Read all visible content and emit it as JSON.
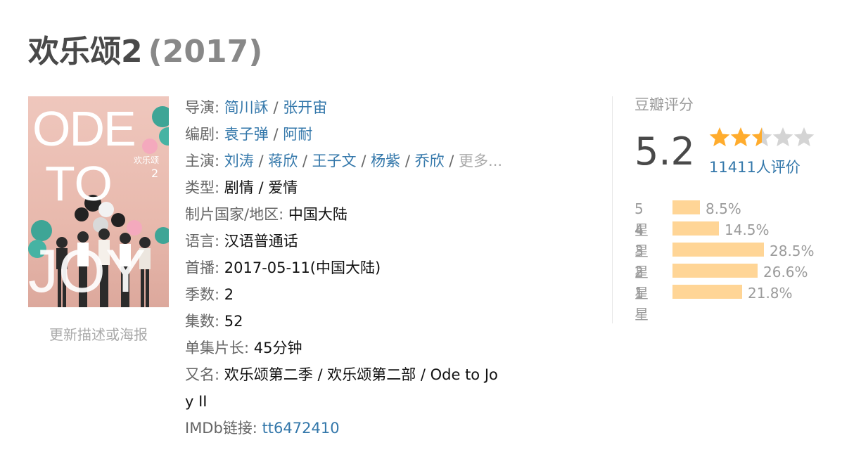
{
  "title": {
    "name": "欢乐颂2",
    "year": "(2017)"
  },
  "poster": {
    "alt_text": "Ode to Joy 2 poster",
    "big_text": [
      "ODE",
      "TO",
      "JOY"
    ],
    "cn_text": "欢乐颂",
    "num_text": "2"
  },
  "update_link": "更新描述或海报",
  "info": {
    "director": {
      "label": "导演:",
      "names": [
        "简川訸",
        "张开宙"
      ]
    },
    "writer": {
      "label": "编剧:",
      "names": [
        "袁子弹",
        "阿耐"
      ]
    },
    "cast": {
      "label": "主演:",
      "names": [
        "刘涛",
        "蒋欣",
        "王子文",
        "杨紫",
        "乔欣"
      ],
      "more": "更多..."
    },
    "genre": {
      "label": "类型:",
      "value": "剧情 / 爱情"
    },
    "country": {
      "label": "制片国家/地区:",
      "value": "中国大陆"
    },
    "language": {
      "label": "语言:",
      "value": "汉语普通话"
    },
    "premiere": {
      "label": "首播:",
      "value": "2017-05-11(中国大陆)"
    },
    "seasons": {
      "label": "季数:",
      "value": "2"
    },
    "episodes": {
      "label": "集数:",
      "value": "52"
    },
    "runtime": {
      "label": "单集片长:",
      "value": "45分钟"
    },
    "aka": {
      "label": "又名:",
      "line1": "欢乐颂第二季 / 欢乐颂第二部 / Ode to Jo",
      "line2": "y II"
    },
    "imdb": {
      "label": "IMDb链接:",
      "id": "tt6472410"
    }
  },
  "rating": {
    "title": "豆瓣评分",
    "score": "5.2",
    "stars_value": 2.5,
    "stars_max": 5,
    "votes": "11411人评价",
    "colors": {
      "star_on": "#ffac2d",
      "star_off": "#d4d4d4",
      "bar": "#ffd596"
    },
    "distribution": [
      {
        "label": "5星",
        "percent": "8.5%",
        "value": 8.5
      },
      {
        "label": "4星",
        "percent": "14.5%",
        "value": 14.5
      },
      {
        "label": "3星",
        "percent": "28.5%",
        "value": 28.5
      },
      {
        "label": "2星",
        "percent": "26.6%",
        "value": 26.6
      },
      {
        "label": "1星",
        "percent": "21.8%",
        "value": 21.8
      }
    ]
  }
}
